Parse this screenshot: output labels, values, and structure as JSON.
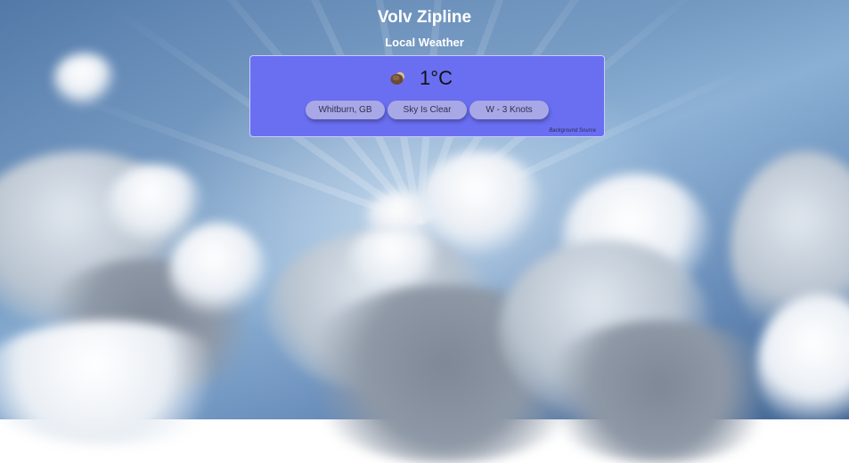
{
  "header": {
    "title": "Volv Zipline",
    "subtitle": "Local Weather"
  },
  "weather": {
    "icon": "partly-cloudy-night-icon",
    "temperature": "1°C",
    "location": "Whitburn, GB",
    "condition": "Sky Is Clear",
    "wind": "W - 3 Knots",
    "background_source_link": "Background Source"
  },
  "colors": {
    "card_background": "#6a6ff2",
    "chip_background": "#a9a8e6",
    "sky": "#6d93bd"
  }
}
